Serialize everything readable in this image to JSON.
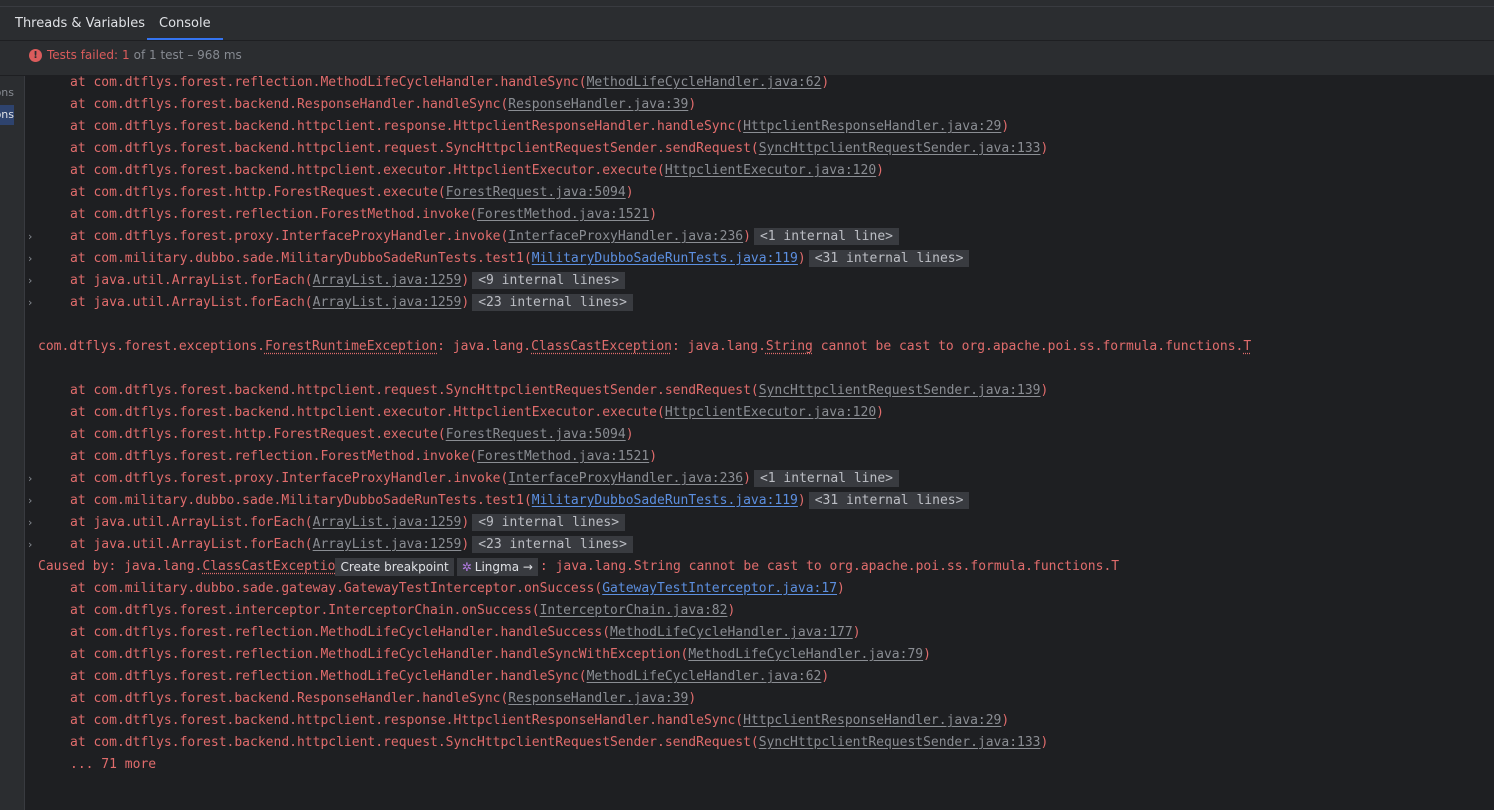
{
  "tabs": [
    {
      "label": "Threads & Variables",
      "active": false
    },
    {
      "label": "Console",
      "active": true
    }
  ],
  "status": {
    "icon": "error-icon",
    "failed_label": "Tests failed:",
    "failed_count": "1",
    "summary": "of 1 test – 968 ms"
  },
  "left_panel": {
    "item1": "ons",
    "item2": "ons"
  },
  "console": {
    "lines": [
      {
        "kind": "frame",
        "pre": "at com.dtflys.forest.reflection.MethodLifeCycleHandler.handleSync(",
        "src": "MethodLifeCycleHandler.java:62",
        "post": ")"
      },
      {
        "kind": "frame",
        "pre": "at com.dtflys.forest.backend.ResponseHandler.handleSync(",
        "src": "ResponseHandler.java:39",
        "post": ")"
      },
      {
        "kind": "frame",
        "pre": "at com.dtflys.forest.backend.httpclient.response.HttpclientResponseHandler.handleSync(",
        "src": "HttpclientResponseHandler.java:29",
        "post": ")"
      },
      {
        "kind": "frame",
        "pre": "at com.dtflys.forest.backend.httpclient.request.SyncHttpclientRequestSender.sendRequest(",
        "src": "SyncHttpclientRequestSender.java:133",
        "post": ")"
      },
      {
        "kind": "frame",
        "pre": "at com.dtflys.forest.backend.httpclient.executor.HttpclientExecutor.execute(",
        "src": "HttpclientExecutor.java:120",
        "post": ")"
      },
      {
        "kind": "frame",
        "pre": "at com.dtflys.forest.http.ForestRequest.execute(",
        "src": "ForestRequest.java:5094",
        "post": ")"
      },
      {
        "kind": "frame",
        "pre": "at com.dtflys.forest.reflection.ForestMethod.invoke(",
        "src": "ForestMethod.java:1521",
        "post": ")"
      },
      {
        "kind": "frame",
        "chev": true,
        "pre": "at com.dtflys.forest.proxy.InterfaceProxyHandler.invoke(",
        "src": "InterfaceProxyHandler.java:236",
        "post": ")",
        "fold": "<1 internal line>"
      },
      {
        "kind": "frame",
        "chev": true,
        "pre": "at com.military.dubbo.sade.MilitaryDubboSadeRunTests.test1(",
        "src": "MilitaryDubboSadeRunTests.java:119",
        "link": true,
        "post": ")",
        "fold": "<31 internal lines>"
      },
      {
        "kind": "frame",
        "chev": true,
        "pre": "at java.util.ArrayList.forEach(",
        "src": "ArrayList.java:1259",
        "post": ")",
        "fold": "<9 internal lines>"
      },
      {
        "kind": "frame",
        "chev": true,
        "pre": "at java.util.ArrayList.forEach(",
        "src": "ArrayList.java:1259",
        "post": ")",
        "fold": "<23 internal lines>"
      },
      {
        "kind": "blank"
      },
      {
        "kind": "exc",
        "parts": [
          {
            "t": "com.dtflys.forest.exceptions."
          },
          {
            "t": "ForestRuntimeException",
            "cls": true
          },
          {
            "t": ": java.lang."
          },
          {
            "t": "ClassCastException",
            "cls": true
          },
          {
            "t": ": java.lang."
          },
          {
            "t": "String",
            "cls": true
          },
          {
            "t": " cannot be cast to org.apache.poi.ss.formula.functions."
          },
          {
            "t": "T",
            "cls": true
          }
        ]
      },
      {
        "kind": "blank"
      },
      {
        "kind": "frame",
        "pre": "at com.dtflys.forest.backend.httpclient.request.SyncHttpclientRequestSender.sendRequest(",
        "src": "SyncHttpclientRequestSender.java:139",
        "post": ")"
      },
      {
        "kind": "frame",
        "pre": "at com.dtflys.forest.backend.httpclient.executor.HttpclientExecutor.execute(",
        "src": "HttpclientExecutor.java:120",
        "post": ")"
      },
      {
        "kind": "frame",
        "pre": "at com.dtflys.forest.http.ForestRequest.execute(",
        "src": "ForestRequest.java:5094",
        "post": ")"
      },
      {
        "kind": "frame",
        "pre": "at com.dtflys.forest.reflection.ForestMethod.invoke(",
        "src": "ForestMethod.java:1521",
        "post": ")"
      },
      {
        "kind": "frame",
        "chev": true,
        "pre": "at com.dtflys.forest.proxy.InterfaceProxyHandler.invoke(",
        "src": "InterfaceProxyHandler.java:236",
        "post": ")",
        "fold": "<1 internal line>"
      },
      {
        "kind": "frame",
        "chev": true,
        "pre": "at com.military.dubbo.sade.MilitaryDubboSadeRunTests.test1(",
        "src": "MilitaryDubboSadeRunTests.java:119",
        "link": true,
        "post": ")",
        "fold": "<31 internal lines>"
      },
      {
        "kind": "frame",
        "chev": true,
        "pre": "at java.util.ArrayList.forEach(",
        "src": "ArrayList.java:1259",
        "post": ")",
        "fold": "<9 internal lines>"
      },
      {
        "kind": "frame",
        "chev": true,
        "pre": "at java.util.ArrayList.forEach(",
        "src": "ArrayList.java:1259",
        "post": ")",
        "fold": "<23 internal lines>"
      },
      {
        "kind": "cause",
        "pre": "Caused by: java.lang.",
        "cls": "ClassCastExceptio",
        "hint": "Create breakpoint",
        "ai": "Lingma →",
        "ai_icon": "lingma-icon",
        "post": ": java.lang.String cannot be cast to org.apache.poi.ss.formula.functions.T"
      },
      {
        "kind": "frame",
        "pre": "at com.military.dubbo.sade.gateway.GatewayTestInterceptor.onSuccess(",
        "src": "GatewayTestInterceptor.java:17",
        "link": true,
        "post": ")"
      },
      {
        "kind": "frame",
        "pre": "at com.dtflys.forest.interceptor.InterceptorChain.onSuccess(",
        "src": "InterceptorChain.java:82",
        "post": ")"
      },
      {
        "kind": "frame",
        "pre": "at com.dtflys.forest.reflection.MethodLifeCycleHandler.handleSuccess(",
        "src": "MethodLifeCycleHandler.java:177",
        "post": ")"
      },
      {
        "kind": "frame",
        "pre": "at com.dtflys.forest.reflection.MethodLifeCycleHandler.handleSyncWithException(",
        "src": "MethodLifeCycleHandler.java:79",
        "post": ")"
      },
      {
        "kind": "frame",
        "pre": "at com.dtflys.forest.reflection.MethodLifeCycleHandler.handleSync(",
        "src": "MethodLifeCycleHandler.java:62",
        "post": ")"
      },
      {
        "kind": "frame",
        "pre": "at com.dtflys.forest.backend.ResponseHandler.handleSync(",
        "src": "ResponseHandler.java:39",
        "post": ")"
      },
      {
        "kind": "frame",
        "pre": "at com.dtflys.forest.backend.httpclient.response.HttpclientResponseHandler.handleSync(",
        "src": "HttpclientResponseHandler.java:29",
        "post": ")"
      },
      {
        "kind": "frame",
        "pre": "at com.dtflys.forest.backend.httpclient.request.SyncHttpclientRequestSender.sendRequest(",
        "src": "SyncHttpclientRequestSender.java:133",
        "post": ")"
      },
      {
        "kind": "frame",
        "pre": "... 71 more"
      }
    ]
  }
}
